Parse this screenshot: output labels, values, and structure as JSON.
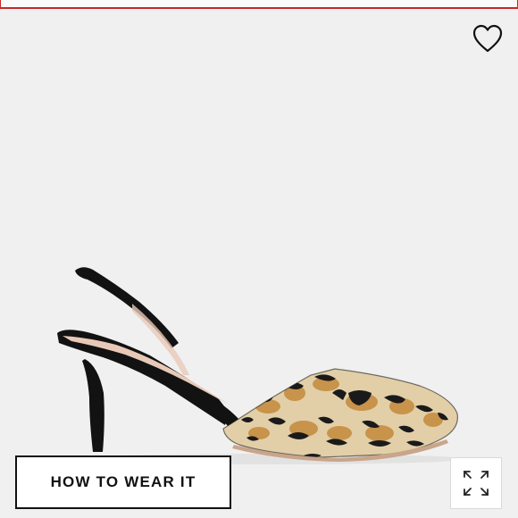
{
  "page": {
    "background_color": "#f0f0f0",
    "top_bar_color": "#c62828"
  },
  "favorite": {
    "icon": "heart-outline-icon"
  },
  "product": {
    "image_subject": "leopard-print-slingback-pump",
    "colors": {
      "leopard_base": "#e2cfa8",
      "leopard_tan": "#c8934a",
      "leopard_spot": "#1a1a1a",
      "suede": "#121212",
      "lining": "#e8c9b8"
    }
  },
  "cta": {
    "label": "HOW TO WEAR IT"
  },
  "expand": {
    "icon": "expand-arrows-icon"
  }
}
